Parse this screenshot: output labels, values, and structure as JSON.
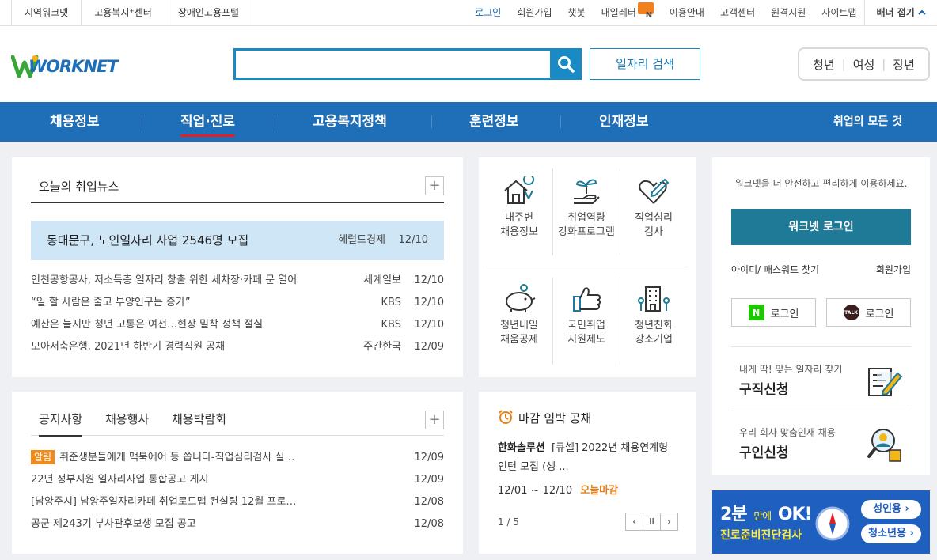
{
  "topbar": {
    "left_links": [
      "지역워크넷",
      "고용복지⁺센터",
      "장애인고용포털"
    ],
    "login": "로그인",
    "right_links": [
      "회원가입",
      "챗봇",
      "내일레터",
      "이용안내",
      "고객센터",
      "원격지원",
      "사이트맵"
    ],
    "newsletter_badge": "N",
    "banner_close": "배너 접기"
  },
  "header": {
    "logo_text": "WORKNET",
    "search_placeholder": "",
    "job_search_label": "일자리 검색",
    "segments": [
      "청년",
      "여성",
      "장년"
    ],
    "segment_separator": "|"
  },
  "nav": {
    "items": [
      "채용정보",
      "직업·진로",
      "고용복지정책",
      "훈련정보",
      "인재정보"
    ],
    "all_label": "취업의 모든 것"
  },
  "news": {
    "tab_title": "오늘의 취업뉴스",
    "plus": "+",
    "featured": {
      "title": "동대문구, 노인일자리 사업 2546명 모집",
      "source": "헤럴드경제",
      "date": "12/10"
    },
    "items": [
      {
        "title": "인천공항공사, 저소득층 일자리 창출 위한 세차장·카페 문 열어",
        "source": "세계일보",
        "date": "12/10"
      },
      {
        "title": "“일 할 사람은 줄고 부양인구는 증가”",
        "source": "KBS",
        "date": "12/10"
      },
      {
        "title": "예산은 늘지만 청년 고통은 여전…현장 밀착 정책 절실",
        "source": "KBS",
        "date": "12/10"
      },
      {
        "title": "모아저축은행, 2021년 하반기 경력직원 공채",
        "source": "주간한국",
        "date": "12/09"
      }
    ]
  },
  "notice": {
    "tabs": [
      "공지사항",
      "채용행사",
      "채용박람회"
    ],
    "plus": "+",
    "alert_tag": "알림",
    "items": [
      {
        "title": "취준생분들에게 맥북에어 등 쏩니다-직업심리검사 실…",
        "date": "12/09"
      },
      {
        "title": "22년 정부지원 일자리사업 통합공고 게시",
        "date": "12/09"
      },
      {
        "title": "[남양주시] 남양주일자리카페 취업로드맵 컨설팅 12월 프로…",
        "date": "12/08"
      },
      {
        "title": "공군 제243기 부사관후보생 모집 공고",
        "date": "12/08"
      }
    ]
  },
  "quick_menu": {
    "row1": [
      {
        "line1": "내주변",
        "line2": "채용정보",
        "icon": "house-location-icon"
      },
      {
        "line1": "취업역량",
        "line2": "강화프로그램",
        "icon": "sprout-hand-icon"
      },
      {
        "line1": "직업심리",
        "line2": "검사",
        "icon": "heart-pencil-icon"
      }
    ],
    "row2": [
      {
        "line1": "청년내일",
        "line2": "채움공제",
        "icon": "piggy-bank-icon"
      },
      {
        "line1": "국민취업",
        "line2": "지원제도",
        "icon": "thumbs-up-icon"
      },
      {
        "line1": "청년친화",
        "line2": "강소기업",
        "icon": "building-icon"
      }
    ]
  },
  "deadline": {
    "title": "마감 임박 공채",
    "company": "한화솔루션",
    "job": "[큐셀] 2022년 채용연계형 인턴 모집 (생 ...",
    "period": "12/01 ~ 12/10",
    "today_badge": "오늘마감",
    "page": "1 / 5",
    "pager": [
      "‹",
      "II",
      "›"
    ]
  },
  "login_panel": {
    "message": "워크넷을 더 안전하고 편리하게 이용하세요.",
    "login_button": "워크넷 로그인",
    "find_link": "아이디/ 패스워드 찾기",
    "join_link": "회원가입",
    "naver_login": "로그인",
    "naver_icon_text": "N",
    "kakao_login": "로그인",
    "kakao_icon_text": "TALK",
    "job_seek_sub": "내게 딱! 맞는 일자리 찾기",
    "job_seek_main": "구직신청",
    "recruit_sub": "우리 회사 맞춤인재 채용",
    "recruit_main": "구인신청"
  },
  "banner": {
    "text_2min": "2분",
    "text_within": "만에",
    "text_ok": "OK!",
    "subtitle": "진로준비진단검사",
    "adult_button": "성인용 ›",
    "youth_button": "청소년용 ›"
  },
  "colors": {
    "nav_blue": "#1f6fb8",
    "accent_teal": "#1e7a96",
    "search_blue": "#1a8ac4",
    "active_underline": "#e51e26",
    "orange": "#f08a1d"
  }
}
